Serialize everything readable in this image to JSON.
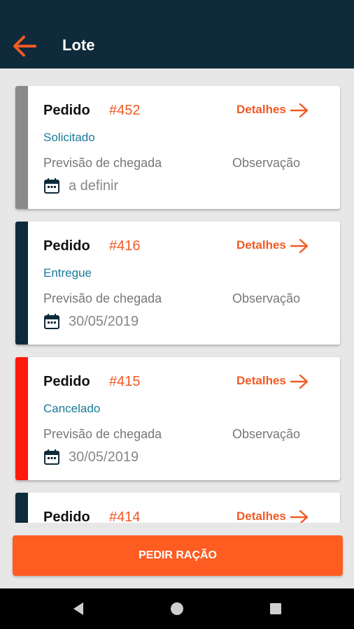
{
  "appbar": {
    "title": "Lote",
    "back_icon": "arrow-left-icon",
    "accent": "#f05a24"
  },
  "orders": [
    {
      "label": "Pedido",
      "number": "#452",
      "details": "Detalhes",
      "status": "Solicitado",
      "forecast_label": "Previsão de chegada",
      "observation_label": "Observação",
      "date": "a definir",
      "stripe_color": "#8a8a8a"
    },
    {
      "label": "Pedido",
      "number": "#416",
      "details": "Detalhes",
      "status": "Entregue",
      "forecast_label": "Previsão de chegada",
      "observation_label": "Observação",
      "date": "30/05/2019",
      "stripe_color": "#0f2a3a"
    },
    {
      "label": "Pedido",
      "number": "#415",
      "details": "Detalhes",
      "status": "Cancelado",
      "forecast_label": "Previsão de chegada",
      "observation_label": "Observação",
      "date": "30/05/2019",
      "stripe_color": "#ff1a0d"
    },
    {
      "label": "Pedido",
      "number": "#414",
      "details": "Detalhes",
      "stripe_color": "#0f2a3a"
    }
  ],
  "action_button": {
    "label": "PEDIR RAÇÃO",
    "color": "#ff5c22"
  },
  "system_nav": {
    "back": "nav-back-icon",
    "home": "nav-home-icon",
    "recents": "nav-recents-icon"
  }
}
